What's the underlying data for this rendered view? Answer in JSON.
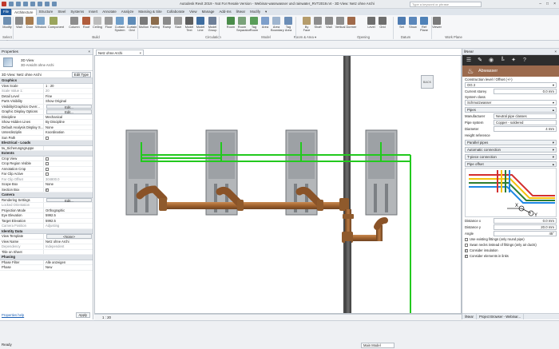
{
  "window": {
    "title": "Autodesk Revit 2019 - Not For Resale Version - Webinar-wasswasser und rainwater_RVT2019.rvt - 3D View: Netz ohne Archi",
    "search_placeholder": "Type a keyword or phrase"
  },
  "ribbon": {
    "tabs": [
      "File",
      "Architecture",
      "Structure",
      "Steel",
      "Systems",
      "Insert",
      "Annotate",
      "Analyze",
      "Massing & Site",
      "Collaborate",
      "View",
      "Manage",
      "Add-Ins",
      "liNear",
      "Modify",
      "▾"
    ],
    "active_tab": "Architecture",
    "buttons": [
      {
        "label": "Modify",
        "color": "#6e8fb1"
      },
      {
        "label": "Wall",
        "color": "#8a8a8a"
      },
      {
        "label": "Door",
        "color": "#a77c4f"
      },
      {
        "label": "Window",
        "color": "#7fa6c9"
      },
      {
        "label": "Component",
        "color": "#9aa55c"
      },
      {
        "label": "Column",
        "color": "#8d8d8d"
      },
      {
        "label": "Roof",
        "color": "#b05c3c"
      },
      {
        "label": "Ceiling",
        "color": "#bcbcbc"
      },
      {
        "label": "Floor",
        "color": "#9a9a9a"
      },
      {
        "label": "Curtain System",
        "color": "#6f9ec9"
      },
      {
        "label": "Curtain Grid",
        "color": "#5e8bb7"
      },
      {
        "label": "Mullion",
        "color": "#7a7a7a"
      },
      {
        "label": "Railing",
        "color": "#8b6c4c"
      },
      {
        "label": "Ramp",
        "color": "#8a8a8a"
      },
      {
        "label": "Stair",
        "color": "#9b9b9b"
      },
      {
        "label": "Model Text",
        "color": "#5e5e5e"
      },
      {
        "label": "Model Line",
        "color": "#3e6da0"
      },
      {
        "label": "Model Group",
        "color": "#6d7f98"
      },
      {
        "label": "Room",
        "color": "#4a8c4a"
      },
      {
        "label": "Room Separator",
        "color": "#7aa27a"
      },
      {
        "label": "Tag Room",
        "color": "#5a9e5a"
      },
      {
        "label": "Area",
        "color": "#7d9fcb"
      },
      {
        "label": "Area Boundary",
        "color": "#9fb5cf"
      },
      {
        "label": "Tag Area",
        "color": "#6b8db6"
      },
      {
        "label": "By Face",
        "color": "#b59c6b"
      },
      {
        "label": "Shaft",
        "color": "#8c8c8c"
      },
      {
        "label": "Wall",
        "color": "#8a8a8a"
      },
      {
        "label": "Vertical",
        "color": "#8e8e8e"
      },
      {
        "label": "Dormer",
        "color": "#a06a4a"
      },
      {
        "label": "Level",
        "color": "#6e6e6e"
      },
      {
        "label": "Grid",
        "color": "#6e6e6e"
      },
      {
        "label": "Set",
        "color": "#4e7bb1"
      },
      {
        "label": "Show",
        "color": "#5b87bb"
      },
      {
        "label": "Ref Plane",
        "color": "#4f82b8"
      },
      {
        "label": "Viewer",
        "color": "#7a7a7a"
      }
    ],
    "groups": [
      "Select ▾",
      "Build",
      "Circulation",
      "Model",
      "Room & Area ▾",
      "Opening",
      "Datum",
      "Work Plane"
    ]
  },
  "properties": {
    "header": "Properties",
    "type_line1": "3D View",
    "type_line2": "3D-Ansicht ohne Archi",
    "selector": "3D View: Netz ohne Archi",
    "edit_type": "Edit Type",
    "groups": [
      {
        "name": "Graphics",
        "rows": [
          {
            "k": "View Scale",
            "v": "1 : 20"
          },
          {
            "k": "Scale Value  1:",
            "v": "20",
            "grey": true
          },
          {
            "k": "Detail Level",
            "v": "Fine"
          },
          {
            "k": "Parts Visibility",
            "v": "Show Original"
          },
          {
            "k": "Visibility/Graphics Overr...",
            "v": "Edit...",
            "button": true
          },
          {
            "k": "Graphic Display Options",
            "v": "Edit...",
            "button": true
          },
          {
            "k": "Discipline",
            "v": "Mechanical"
          },
          {
            "k": "Show Hidden Lines",
            "v": "By Discipline"
          },
          {
            "k": "Default Analysis Display S...",
            "v": "None"
          },
          {
            "k": "Unterdisziplin",
            "v": "Koordination"
          },
          {
            "k": "Sun Path",
            "v": "",
            "check": false
          }
        ]
      },
      {
        "name": "Electrical - Loads",
        "rows": [
          {
            "k": "tw_Sicherungsgruppe",
            "v": ""
          }
        ]
      },
      {
        "name": "Extents",
        "rows": [
          {
            "k": "Crop View",
            "v": "",
            "check": false
          },
          {
            "k": "Crop Region Visible",
            "v": "",
            "check": false
          },
          {
            "k": "Annotation Crop",
            "v": "",
            "check": false
          },
          {
            "k": "Far Clip Active",
            "v": "",
            "check": false
          },
          {
            "k": "Far Clip Offset",
            "v": "304800.0",
            "grey": true
          },
          {
            "k": "Scope Box",
            "v": "None"
          },
          {
            "k": "Section Box",
            "v": "",
            "check": true
          }
        ]
      },
      {
        "name": "Camera",
        "rows": [
          {
            "k": "Rendering Settings",
            "v": "Edit...",
            "button": true
          },
          {
            "k": "Locked Orientation",
            "v": "",
            "grey": true
          },
          {
            "k": "Projection Mode",
            "v": "Orthographic"
          },
          {
            "k": "Eye Elevation",
            "v": "5992.5"
          },
          {
            "k": "Target Elevation",
            "v": "5992.5"
          },
          {
            "k": "Camera Position",
            "v": "Adjusting",
            "grey": true
          }
        ]
      },
      {
        "name": "Identity Data",
        "rows": [
          {
            "k": "View Template",
            "v": "<None>",
            "button": true
          },
          {
            "k": "View Name",
            "v": "Netz ohne Archi"
          },
          {
            "k": "Dependency",
            "v": "Independent",
            "grey": true
          },
          {
            "k": "Title on Sheet",
            "v": ""
          }
        ]
      },
      {
        "name": "Phasing",
        "rows": [
          {
            "k": "Phase Filter",
            "v": "Alle anzeigen"
          },
          {
            "k": "Phase",
            "v": "New"
          }
        ]
      }
    ],
    "help_link": "Properties help",
    "apply": "Apply"
  },
  "view": {
    "tab_label": "Netz ohne Archi",
    "viewcube": "BACK",
    "scale": "1 : 20"
  },
  "right_panel": {
    "header": "liNear",
    "brand": "Abwasser",
    "construction_label": "Construction level / Offset (+/-)",
    "construction_value": "OG 2",
    "current_storey": "Current storey",
    "current_storey_value": "0.0 mm",
    "system_class_label": "System class",
    "system_class_value": "Schmutzwasser",
    "pipes_header": "Pipes",
    "manufacturer_label": "Manufacturer",
    "manufacturer_value": "Neutral pipe classes",
    "pipe_system_label": "Pipe system",
    "pipe_system_value": "Copper - soldered",
    "diameter_label": "Diameter",
    "diameter_value": "4 mm",
    "height_label": "Height reference",
    "parallel_pipes": "Parallel pipes",
    "auto_connection": "Automatic connection",
    "tpiece_connection": "T-piece connection",
    "pipe_offset": "Pipe offset",
    "distance_x_label": "Distance x",
    "distance_x_value": "0.0 mm",
    "distance_y_label": "Distance y",
    "distance_y_value": "20.0 mm",
    "angle_label": "Angle",
    "angle_value": "45°",
    "checks": [
      {
        "label": "Use existing fittings (only round pipe)",
        "on": false
      },
      {
        "label": "Swan necks instead of fittings (only air ducts)",
        "on": false
      },
      {
        "label": "Consider insulation",
        "on": true
      },
      {
        "label": "Consider elements in links",
        "on": true
      }
    ],
    "bottom_tabs": [
      "liNear",
      "Project Browser - Webinar..."
    ]
  },
  "status": {
    "text": "Ready",
    "workset": "Main Model"
  },
  "colors": {
    "pipe": "#a0622e",
    "pipe_dark": "#7a4a22",
    "highlight_green": "#22c91e",
    "fixture": "#8f9397",
    "ribbon_file": "#1f5a9e"
  }
}
